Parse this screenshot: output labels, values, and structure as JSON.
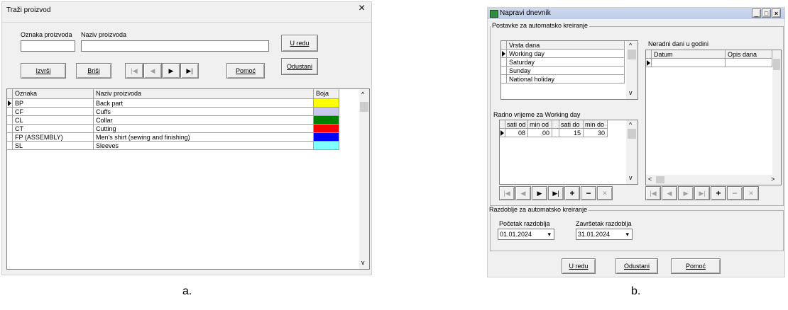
{
  "dialog_a": {
    "title": "Traži proizvod",
    "close_glyph": "×",
    "code_label": "Oznaka proizvoda",
    "name_label": "Naziv proizvoda",
    "code_value": "",
    "name_value": "",
    "ok_label": "U redu",
    "cancel_label": "Odustani",
    "execute_label": "Izvrši",
    "clear_label": "Briši",
    "help_label": "Pomoć",
    "nav": {
      "first": "|◀",
      "prev": "◀",
      "next": "▶",
      "last": "▶|"
    },
    "table": {
      "headers": [
        "Oznaka",
        "Naziv proizvoda",
        "Boja"
      ],
      "rows": [
        {
          "code": "BP",
          "name": "Back part",
          "color": "#ffff00"
        },
        {
          "code": "CF",
          "name": "Cuffs",
          "color": "#c8c8ec"
        },
        {
          "code": "CL",
          "name": "Collar",
          "color": "#008000"
        },
        {
          "code": "CT",
          "name": "Cutting",
          "color": "#ff0000"
        },
        {
          "code": "FP (ASSEMBLY)",
          "name": "Men's shirt (sewing and finishing)",
          "color": "#0000ff"
        },
        {
          "code": "SL",
          "name": "Sleeves",
          "color": "#80ffff"
        }
      ]
    }
  },
  "dialog_b": {
    "title": "Napravi dnevnik",
    "group_auto": "Postavke za automatsko kreiranje",
    "day_type_header": "Vrsta dana",
    "day_types": [
      "Working day",
      "Saturday",
      "Sunday",
      "National holiday"
    ],
    "nonworking_label": "Neradni dani u godini",
    "nonworking_headers": [
      "Datum",
      "Opis dana"
    ],
    "worktime_label": "Radno vrijeme za  Working day",
    "worktime_headers": [
      "sati od",
      "min od",
      "",
      "sati do",
      "min do"
    ],
    "worktime_row": [
      "08",
      "00",
      "",
      "15",
      "30"
    ],
    "group_period": "Razdoblje za automatsko kreiranje",
    "start_label": "Početak razdoblja",
    "end_label": "Završetak razdoblja",
    "start_value": "01.01.2024",
    "end_value": "31.01.2024",
    "ok_label": "U redu",
    "cancel_label": "Odustani",
    "help_label": "Pomoć",
    "window_controls": {
      "minimize": "_",
      "maximize": "□",
      "close": "×"
    },
    "nav": {
      "first": "|◀",
      "prev": "◀",
      "next": "▶",
      "last": "▶|",
      "add": "+",
      "remove": "−",
      "cancel": "✕",
      "scroll_left": "<",
      "scroll_right": ">"
    }
  },
  "captions": {
    "a": "a.",
    "b": "b."
  }
}
